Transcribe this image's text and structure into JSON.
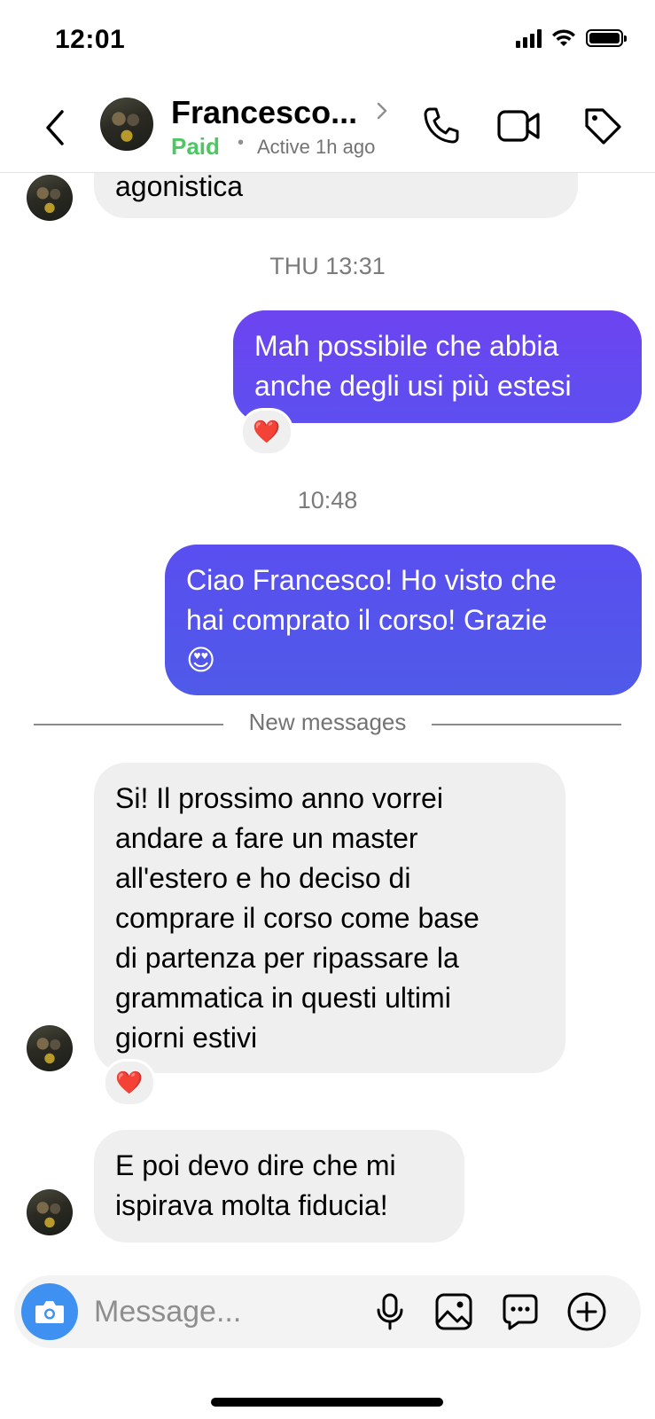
{
  "status_bar": {
    "time": "12:01"
  },
  "header": {
    "contact_name": "Francesco...",
    "paid_label": "Paid",
    "separator": "•",
    "active_status": "Active 1h ago"
  },
  "messages": [
    {
      "id": "m0",
      "direction": "incoming",
      "text": "agonistica"
    },
    {
      "id": "ts1",
      "type": "timestamp",
      "text": "THU 13:31"
    },
    {
      "id": "m1",
      "direction": "outgoing",
      "lines": [
        "Mah possibile che abbia",
        "anche degli usi più estesi"
      ],
      "reaction": "❤️"
    },
    {
      "id": "ts2",
      "type": "timestamp",
      "text": "10:48"
    },
    {
      "id": "m2",
      "direction": "outgoing",
      "lines": [
        "Ciao Francesco! Ho visto che",
        "hai comprato il corso! Grazie",
        "😍"
      ]
    },
    {
      "id": "div",
      "type": "divider",
      "text": "New messages"
    },
    {
      "id": "m3",
      "direction": "incoming",
      "lines": [
        "Si! Il prossimo anno vorrei",
        "andare a fare un master",
        "all'estero e ho deciso di",
        "comprare il corso come base",
        "di partenza per ripassare la",
        "grammatica in questi ultimi",
        "giorni estivi"
      ],
      "reaction": "❤️"
    },
    {
      "id": "m4",
      "direction": "incoming",
      "lines": [
        "E poi devo dire che mi",
        "ispirava molta fiducia!"
      ]
    }
  ],
  "composer": {
    "placeholder": "Message..."
  },
  "colors": {
    "paid": "#4cc762",
    "outgoing_top": "#6d44f0",
    "outgoing_bottom": "#4f5ae8",
    "incoming_bg": "#efefef",
    "camera_button": "#3e91f0"
  }
}
